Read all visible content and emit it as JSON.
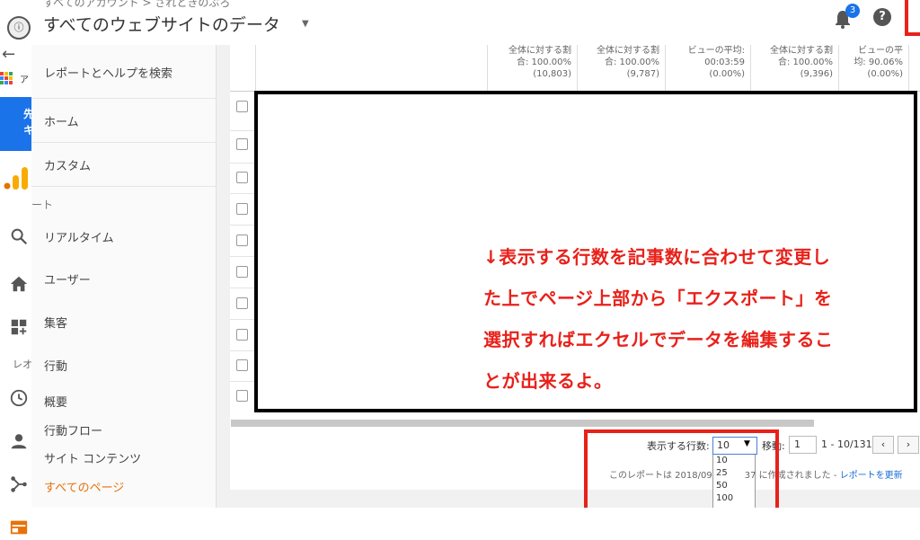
{
  "header": {
    "breadcrumb": "すべてのアカウント > されときのぶろ",
    "title": "すべてのウェブサイトのデータ",
    "notification_count": "3",
    "help_glyph": "?"
  },
  "browser": {
    "tab_glyph": "ⓘ",
    "back_glyph": "←",
    "apps_label": "ア"
  },
  "rail": {
    "blue_chars": [
      "先",
      "キ"
    ],
    "text_reo": "レオ"
  },
  "sidebar": {
    "search_label": "レポートとヘルプを検索",
    "home": "ホーム",
    "custom": "カスタム",
    "report_section": "ート",
    "realtime": "リアルタイム",
    "users": "ユーザー",
    "acquisition": "集客",
    "behavior": "行動",
    "overview": "概要",
    "behavior_flow": "行動フロー",
    "site_content": "サイト コンテンツ",
    "all_pages": "すべてのページ"
  },
  "table": {
    "columns": [
      {
        "line1": "全体に対する割",
        "line2": "合: 100.00%",
        "line3": "(10,803)"
      },
      {
        "line1": "全体に対する割",
        "line2": "合: 100.00%",
        "line3": "(9,787)"
      },
      {
        "line1": "ビューの平均:",
        "line2": "00:03:59",
        "line3": "(0.00%)"
      },
      {
        "line1": "全体に対する割",
        "line2": "合: 100.00%",
        "line3": "(9,396)"
      },
      {
        "line1": "ビューの平",
        "line2": "均: 90.06%",
        "line3": "(0.00%)"
      }
    ]
  },
  "annotation": {
    "lines": [
      "↓表示する行数を記事数に合わせて変更し",
      "た上でページ上部から「エクスポート」を",
      "選択すればエクセルでデータを編集するこ",
      "とが出来るよ。"
    ]
  },
  "pagination": {
    "rows_label": "表示する行数:",
    "rows_selected": "10",
    "rows_options": [
      "10",
      "25",
      "50",
      "100"
    ],
    "move_label": "移動:",
    "page_value": "1",
    "range": "1 - 10/131",
    "prev": "‹",
    "next": "›",
    "created_text": "このレポートは 2018/09",
    "created_suffix": "37 に作成されました - ",
    "refresh_link": "レポートを更新"
  },
  "colors": {
    "accent_blue": "#1a73e8",
    "highlight_red": "#e8211a",
    "active_orange": "#e8710a"
  }
}
